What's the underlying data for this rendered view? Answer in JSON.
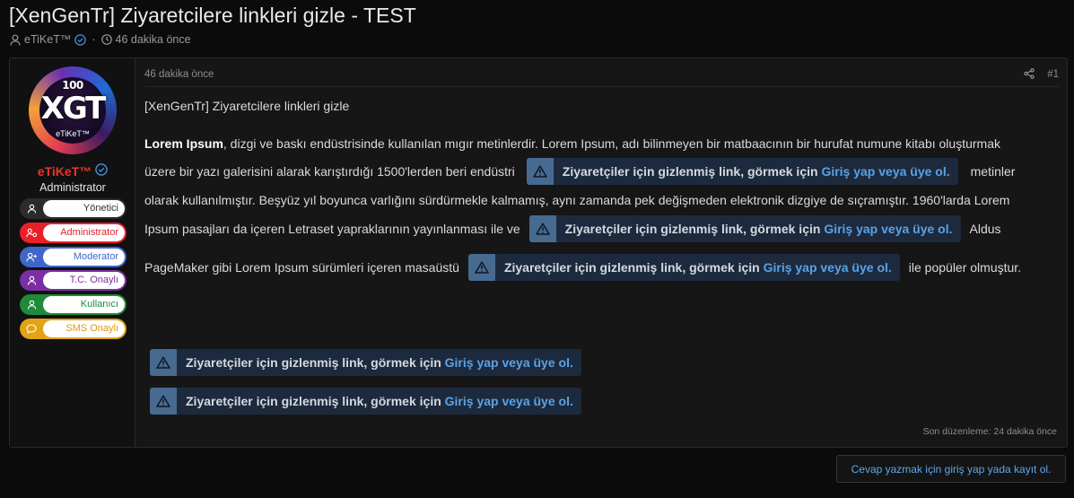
{
  "thread": {
    "title": "[XenGenTr] Ziyaretcilere linkleri gizle - TEST",
    "author": "eTiKeT™",
    "time": "46 dakika önce"
  },
  "post": {
    "date": "46 dakika önce",
    "number": "#1",
    "user": {
      "name": "eTiKeT™",
      "title": "Administrator",
      "avatar_text": {
        "top": "100",
        "main": "XGT",
        "sub": "eTiKeT™"
      },
      "banners": [
        {
          "label": "Yönetici",
          "color": "#2b2b2b",
          "text_color": "#333333",
          "icon": "user-icon"
        },
        {
          "label": "Administrator",
          "color": "#e8202a",
          "text_color": "#e8202a",
          "icon": "users-gear-icon"
        },
        {
          "label": "Moderator",
          "color": "#3f66c9",
          "text_color": "#3f66c9",
          "icon": "user-plus-icon"
        },
        {
          "label": "T.C. Onaylı",
          "color": "#7b2fa3",
          "text_color": "#7b2fa3",
          "icon": "user-icon"
        },
        {
          "label": "Kullanıcı",
          "color": "#1f8a3a",
          "text_color": "#1f8a3a",
          "icon": "user-icon"
        },
        {
          "label": "SMS Onaylı",
          "color": "#e2a317",
          "text_color": "#d99a10",
          "icon": "chat-icon"
        }
      ]
    },
    "heading": "[XenGenTr] Ziyaretcilere linkleri gizle",
    "para": {
      "bold": "Lorem Ipsum",
      "l1": ", dizgi ve baskı endüstrisinde kullanılan mıgır metinlerdir. Lorem Ipsum, adı bilinmeyen bir matbaacının bir hurufat numune kitabı oluşturmak",
      "l2a": "üzere bir yazı galerisini alarak karıştırdığı 1500'lerden beri endüstri",
      "l2b": "metinler",
      "l3": "olarak kullanılmıştır. Beşyüz yıl boyunca varlığını sürdürmekle kalmamış, aynı zamanda pek değişmeden elektronik dizgiye de sıçramıştır. 1960'larda Lorem",
      "l4a": "Ipsum pasajları da içeren Letraset yapraklarının yayınlanması ile ve",
      "l4b": "Aldus",
      "l5a": "PageMaker gibi Lorem Ipsum sürümleri içeren masaüstü",
      "l5b": "ile popüler olmuştur."
    },
    "hidden_link": {
      "text": "Ziyaretçiler için gizlenmiş link, görmek için ",
      "login": "Giriş yap veya üye ol."
    },
    "edited": "Son düzenleme: 24 dakika önce"
  },
  "reply_button": "Cevap yazmak için giriş yap yada kayıt ol.",
  "colors": {
    "accent_link": "#5aa2e6",
    "username": "#e8352e",
    "warn_bg": "#476a91",
    "hidden_bg": "#1d2a3d"
  }
}
